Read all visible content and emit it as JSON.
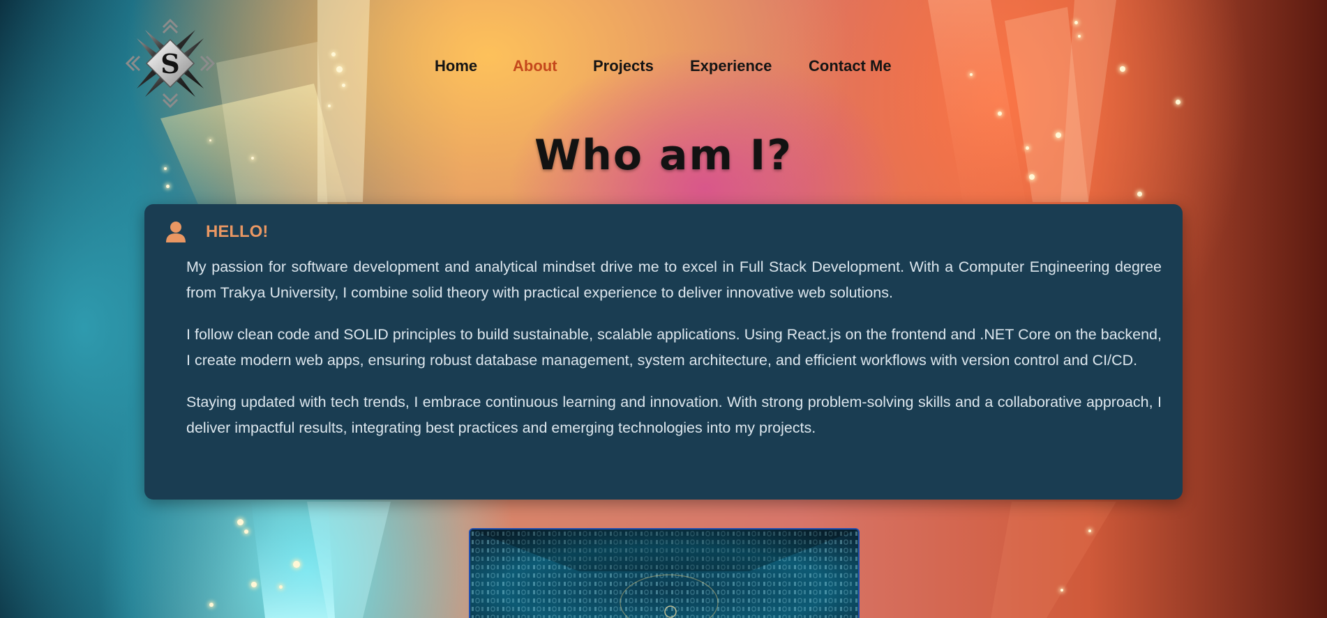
{
  "logo": {
    "letter": "S",
    "icon": "diamond-s-logo-icon"
  },
  "nav": {
    "items": [
      {
        "label": "Home",
        "active": false
      },
      {
        "label": "About",
        "active": true
      },
      {
        "label": "Projects",
        "active": false
      },
      {
        "label": "Experience",
        "active": false
      },
      {
        "label": "Contact Me",
        "active": false
      }
    ],
    "active_color": "#c4481c",
    "text_color": "#141414"
  },
  "page": {
    "title": "Who am I?"
  },
  "about_card": {
    "icon": "user-icon",
    "heading": "HELLO!",
    "paragraphs": [
      "My passion for software development and analytical mindset drive me to excel in Full Stack Development. With a Computer Engineering degree from Trakya University, I combine solid theory with practical experience to deliver innovative web solutions.",
      "I follow clean code and SOLID principles to build sustainable, scalable applications. Using React.js on the frontend and .NET Core on the backend, I create modern web apps, ensuring robust database management, system architecture, and efficient workflows with version control and CI/CD.",
      "Staying updated with tech trends, I embrace continuous learning and innovation. With strong problem-solving skills and a collaborative approach, I deliver impactful results, integrating best practices and emerging technologies into my projects."
    ],
    "background_color": "#1a3d52",
    "heading_color": "#e99763"
  },
  "colors": {
    "accent": "#e99763",
    "card_background": "#1a3d52",
    "image_border": "#1f4fb0"
  }
}
